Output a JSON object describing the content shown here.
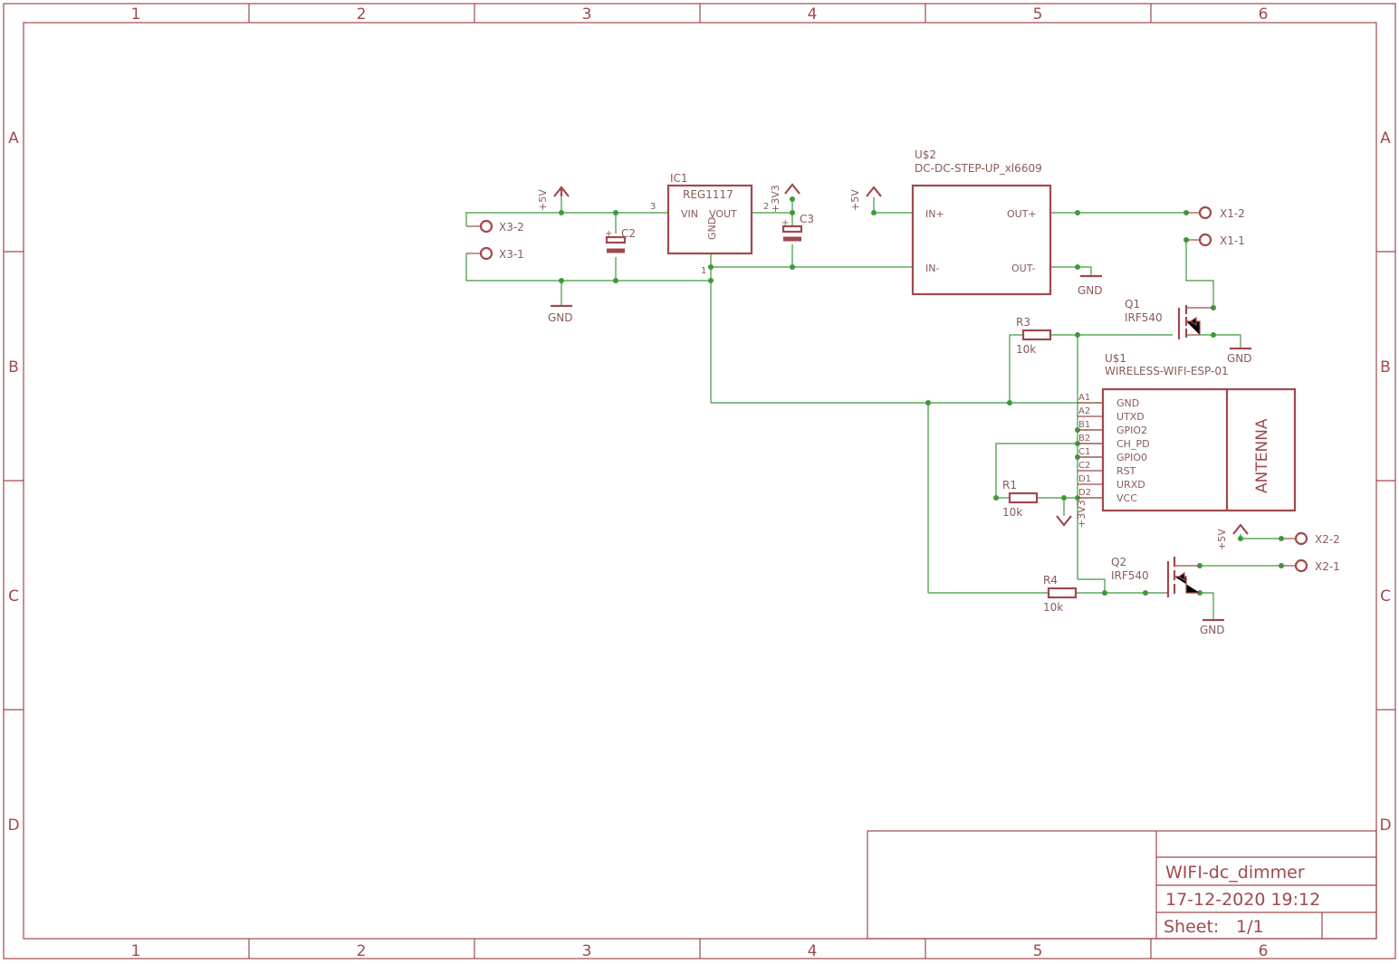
{
  "frame": {
    "columns": [
      "1",
      "2",
      "3",
      "4",
      "5",
      "6"
    ],
    "rows": [
      "A",
      "B",
      "C",
      "D"
    ]
  },
  "title_block": {
    "name": "WIFI-dc_dimmer",
    "date": "17-12-2020 19:12",
    "sheet_label": "Sheet:",
    "sheet_value": "1/1"
  },
  "parts": {
    "ic1": {
      "ref": "IC1",
      "value": "REG1117",
      "pin_vin": "VIN",
      "pin_vout": "VOUT",
      "pin_gnd": "GND",
      "pin3": "3",
      "pin2": "2",
      "pin1": "1"
    },
    "u2": {
      "ref": "U$2",
      "value": "DC-DC-STEP-UP_xl6609",
      "in_plus": "IN+",
      "in_minus": "IN-",
      "out_plus": "OUT+",
      "out_minus": "OUT-"
    },
    "u1": {
      "ref": "U$1",
      "value": "WIRELESS-WIFI-ESP-01",
      "antenna": "ANTENNA",
      "pins": [
        "GND",
        "UTXD",
        "GPIO2",
        "CH_PD",
        "GPIO0",
        "RST",
        "URXD",
        "VCC"
      ],
      "pin_nums": [
        "A1",
        "A2",
        "B1",
        "B2",
        "C1",
        "C2",
        "D1",
        "D2"
      ]
    },
    "q1": {
      "ref": "Q1",
      "value": "IRF540"
    },
    "q2": {
      "ref": "Q2",
      "value": "IRF540"
    },
    "r1": {
      "ref": "R1",
      "value": "10k"
    },
    "r3": {
      "ref": "R3",
      "value": "10k"
    },
    "r4": {
      "ref": "R4",
      "value": "10k"
    },
    "c2": {
      "ref": "C2"
    },
    "c3": {
      "ref": "C3"
    }
  },
  "connectors": {
    "x3_2": "X3-2",
    "x3_1": "X3-1",
    "x1_2": "X1-2",
    "x1_1": "X1-1",
    "x2_2": "X2-2",
    "x2_1": "X2-1"
  },
  "nets": {
    "p5v": "+5V",
    "p3v3": "+3V3",
    "gnd": "GND"
  }
}
